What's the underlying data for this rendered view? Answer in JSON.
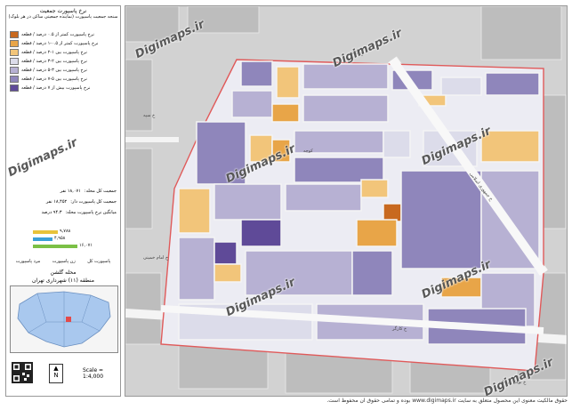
{
  "legend": {
    "title": "نرخ پاسپورت جمعیت",
    "subtitle": "سنجه جمعیت پاسپورت (نماینده جمعیتی ساکن در هر بلوک)",
    "items": [
      {
        "label": "نرخ پاسپورت کمتر از ۰.۵ درصد / قطعه",
        "color": "#c8691f"
      },
      {
        "label": "نرخ پاسپورت کمتر از ۰.۵-۱ درصد / قطعه",
        "color": "#e8a548"
      },
      {
        "label": "نرخ پاسپورت بین ۱-۲ درصد / قطعه",
        "color": "#f2c57a"
      },
      {
        "label": "نرخ پاسپورت بین ۲-۳ درصد / قطعه",
        "color": "#dcdcea"
      },
      {
        "label": "نرخ پاسپورت بین ۳-۵ درصد / قطعه",
        "color": "#b7b1d3"
      },
      {
        "label": "نرخ پاسپورت بین ۵-۷ درصد / قطعه",
        "color": "#8f86bb"
      },
      {
        "label": "نرخ پاسپورت بیش از ۷ درصد / قطعه",
        "color": "#5f4a98"
      }
    ],
    "info": [
      {
        "label": "جمعیت کل محله:",
        "value": "۱۸,۰۷۱ نفر"
      },
      {
        "label": "جمعیت کل پاسپورت دار:",
        "value": "۱۸,۴۵۲ نفر"
      },
      {
        "label": "میانگین نرخ پاسپورت محله:",
        "value": "۹۴.۳ درصد"
      }
    ],
    "bars": [
      {
        "label": "۹,۷۸۸",
        "color": "#e8c33a",
        "width": 28
      },
      {
        "label": "۴,۹۵۸",
        "color": "#3aa0d8",
        "width": 22
      },
      {
        "label": "۱۶,۰۷۱",
        "color": "#7bc046",
        "width": 50
      }
    ],
    "bar_captions": [
      "پاسپورت کل",
      "زن پاسپورت",
      "مرد پاسپورت"
    ],
    "neighborhood_label": "محله گلشن",
    "district_label": "منطقه (۱۱) شهرداری تهران",
    "scale": "Scale = 1:4,000"
  },
  "watermark": "Digimaps.ir",
  "footer": "حقوق مالکیت معنوی این محصول متعلق به سایت www.digimaps.ir بوده و تمامی حقوق آن محفوظ است.",
  "street_labels": [
    "خ گلشن",
    "خ کارگر",
    "خ جمهوری اسلامی",
    "کوچه",
    "خ نوفل لوشاتو",
    "خ سپه",
    "خ امام خمینی"
  ]
}
